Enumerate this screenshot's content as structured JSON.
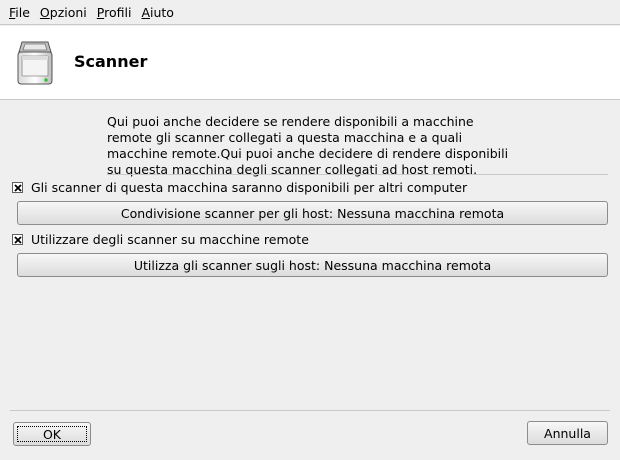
{
  "menubar": {
    "items": [
      {
        "label": "File",
        "mnemonic": "F",
        "rest": "ile"
      },
      {
        "label": "Opzioni",
        "mnemonic": "O",
        "rest": "pzioni"
      },
      {
        "label": "Profili",
        "mnemonic": "P",
        "rest": "rofili"
      },
      {
        "label": "Aiuto",
        "mnemonic": "A",
        "rest": "iuto"
      }
    ]
  },
  "header": {
    "title": "Scanner",
    "icon": "scanner-icon"
  },
  "description": "Qui puoi anche decidere se rendere disponibili a macchine\nremote gli scanner collegati a questa macchina e a quali\nmacchine remote.Qui puoi anche decidere di rendere disponibili\nsu questa macchina degli scanner collegati ad host remoti.",
  "options": {
    "share_checkbox": {
      "label": "Gli scanner di questa macchina saranno disponibili per altri computer",
      "checked": true
    },
    "share_button_label": "Condivisione scanner per gli host: Nessuna macchina remota",
    "use_remote_checkbox": {
      "label": "Utilizzare degli scanner su macchine remote",
      "checked": true
    },
    "use_remote_button_label": "Utilizza gli scanner sugli host: Nessuna macchina remota"
  },
  "footer": {
    "ok_label": "OK",
    "cancel_label": "Annulla"
  }
}
